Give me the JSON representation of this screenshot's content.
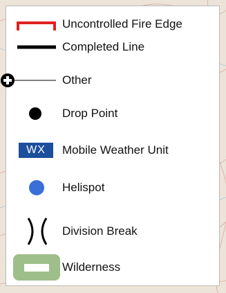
{
  "legend": {
    "items": [
      {
        "label": "Uncontrolled Fire Edge",
        "icon": "uncontrolled-fire-edge-icon",
        "color": "#e02020"
      },
      {
        "label": "Completed Line",
        "icon": "completed-line-icon",
        "color": "#000000"
      },
      {
        "label": "Other",
        "icon": "other-line-icon",
        "color": "#000000"
      },
      {
        "label": "Drop Point",
        "icon": "drop-point-icon",
        "color": "#000000"
      },
      {
        "label": "Mobile Weather Unit",
        "icon": "mobile-weather-unit-icon",
        "color": "#1c4f9c",
        "symbol_text": "WX"
      },
      {
        "label": "Helispot",
        "icon": "helispot-icon",
        "color": "#3a6fd8"
      },
      {
        "label": "Division Break",
        "icon": "division-break-icon",
        "color": "#000000"
      },
      {
        "label": "Wilderness",
        "icon": "wilderness-icon",
        "color": "#9fbf8a"
      }
    ]
  }
}
